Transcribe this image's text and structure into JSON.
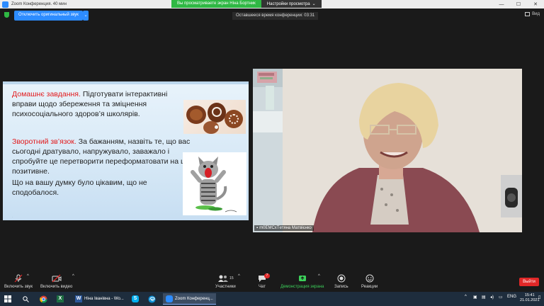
{
  "window": {
    "title": "Zoom Конференция. 40 мин"
  },
  "share_banner": {
    "viewing_text": "Вы просматриваете экран Ніна Бортник",
    "view_options": "Настройки просмотра",
    "view_options_caret": "⌄"
  },
  "window_controls": {
    "minimize": "—",
    "maximize": "☐",
    "close": "✕"
  },
  "top_strip": {
    "original_sound_label": "Отключить оригинальный звук",
    "original_sound_caret": "⌄",
    "remaining_time": "Оставшееся время конференции: 03:31",
    "view_label": "Вид"
  },
  "slide": {
    "homework_heading": "Домашнє завдання.",
    "homework_text": "  Підготувати інтерактивні вправи  щодо  збереження та зміцнення психосоціального здоров’я школярів.",
    "feedback_heading": "Зворотний зв’язок.",
    "feedback_text": " За бажанням, назвіть те, що вас сьогодні дратувало, напружувало, заважало і спробуйте це перетворити переформатовати на щось позитивне.",
    "closing_text": "Що на вашу думку було цікавим, що не сподобалося."
  },
  "video": {
    "participant_name": "m0EMCxTетяна Матвієнко"
  },
  "toolbar": {
    "mute_label": "Включить звук",
    "video_label": "Включить видео",
    "participants_label": "Участники",
    "participants_count": "15",
    "chat_label": "Чат",
    "chat_badge": "7",
    "share_label": "Демонстрация экрана",
    "record_label": "Запись",
    "reactions_label": "Реакции",
    "end_label": "Выйти",
    "caret": "^"
  },
  "taskbar": {
    "search_icon": "search-icon",
    "apps": [
      {
        "label": "Ніна Іванівна - Wo..."
      },
      {
        "label": "Zoom Конференц..."
      }
    ],
    "language": "ENG",
    "time": "15:41",
    "date": "21.01.2021"
  },
  "colors": {
    "accent_blue": "#2d8cff",
    "share_green": "#2fb844",
    "end_red": "#e02828",
    "slide_heading_red": "#e2191b"
  }
}
